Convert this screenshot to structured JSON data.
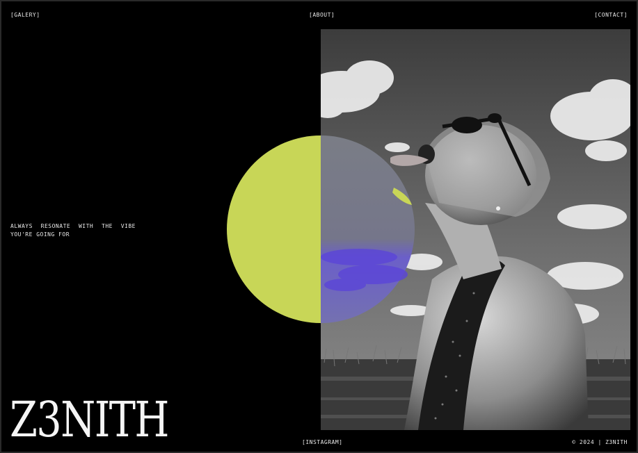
{
  "nav": {
    "gallery": "[GALERY]",
    "about": "[ABOUT]",
    "contact": "[CONTACT]"
  },
  "hero": {
    "tagline": "ALWAYS RESONATE WITH THE VIBE YOU'RE GOING FOR",
    "logo": "Z3NITH"
  },
  "footer": {
    "instagram": "[INSTAGRAM]",
    "copyright": "© 2024 | Z3NITH"
  },
  "colors": {
    "background": "#000000",
    "accent_lime": "#c8d657",
    "accent_violet": "#6a5acd"
  }
}
